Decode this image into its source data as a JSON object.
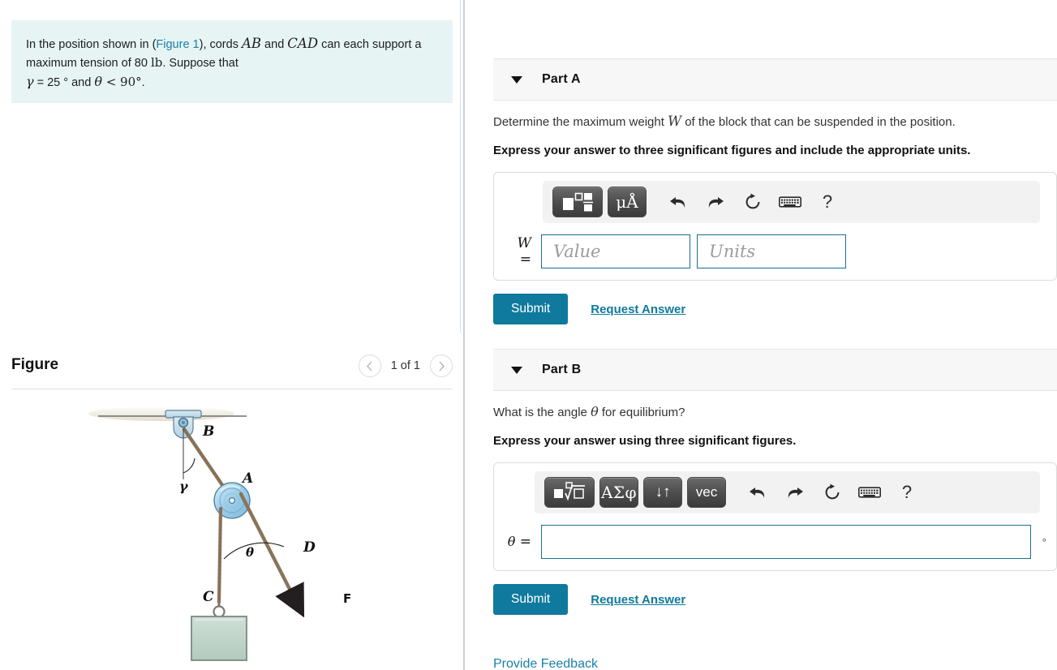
{
  "problem": {
    "line1_a": "In the position shown in (",
    "figure_link": "Figure 1",
    "line1_b": "), cords ",
    "cord1": "AB",
    "and1": " and ",
    "cord2": "CAD",
    "line1_c": " can each",
    "line2": "support a maximum tension of 80 ",
    "unit": "lb",
    "line2_b": ". Suppose that",
    "gamma_sym": "γ",
    "gamma_eq": " = 25 ",
    "deg": "°",
    "and2": " and ",
    "theta_sym": "θ",
    "theta_cond": " < 90°",
    "period": "."
  },
  "figure": {
    "title": "Figure",
    "prev_icon": "chevron-left-icon",
    "next_icon": "chevron-right-icon",
    "counter": "1 of 1",
    "labels": {
      "B": "B",
      "A": "A",
      "C": "C",
      "D": "D",
      "F": "F",
      "gamma": "γ",
      "theta": "θ"
    },
    "colors": {
      "pulley": "#a8d4ea",
      "bracket": "#c3dced",
      "block": "#bdd3c9",
      "cord": "#7d6a55",
      "ceiling": "#e6e1d2"
    }
  },
  "parts": [
    {
      "id": "part-a",
      "caret_icon": "caret-down-icon",
      "title": "Part A",
      "question": "Determine the maximum weight W of the block that can be suspended in the position.",
      "question_pre": "Determine the maximum weight ",
      "question_var": "W",
      "question_post": " of the block that can be suspended in the position.",
      "instruction": "Express your answer to three significant figures and include the appropriate units.",
      "toolbar": [
        {
          "name": "template-fraction-icon",
          "label": "",
          "style": "icon-template"
        },
        {
          "name": "units-micro-angstrom-icon",
          "label": "μÅ",
          "style": "button"
        },
        {
          "name": "undo-icon",
          "label": "",
          "style": "plain"
        },
        {
          "name": "redo-icon",
          "label": "",
          "style": "plain"
        },
        {
          "name": "reset-icon",
          "label": "",
          "style": "plain"
        },
        {
          "name": "keyboard-icon",
          "label": "",
          "style": "plain"
        },
        {
          "name": "help-icon",
          "label": "?",
          "style": "plain"
        }
      ],
      "lhs": "W",
      "equals": "=",
      "value_placeholder": "Value",
      "units_placeholder": "Units",
      "submit_label": "Submit",
      "request_label": "Request Answer"
    },
    {
      "id": "part-b",
      "caret_icon": "caret-down-icon",
      "title": "Part B",
      "question_pre": "What is the angle ",
      "question_var": "θ",
      "question_post": " for equilibrium?",
      "instruction": "Express your answer using three significant figures.",
      "toolbar": [
        {
          "name": "template-root-icon",
          "label": "",
          "style": "icon-root"
        },
        {
          "name": "greek-symbols-icon",
          "label": "ΑΣφ",
          "style": "button"
        },
        {
          "name": "arrows-updown-icon",
          "label": "↓↑",
          "style": "button"
        },
        {
          "name": "vector-icon",
          "label": "vec",
          "style": "button"
        },
        {
          "name": "undo-icon",
          "label": "",
          "style": "plain"
        },
        {
          "name": "redo-icon",
          "label": "",
          "style": "plain"
        },
        {
          "name": "reset-icon",
          "label": "",
          "style": "plain"
        },
        {
          "name": "keyboard-icon",
          "label": "",
          "style": "plain"
        },
        {
          "name": "help-icon",
          "label": "?",
          "style": "plain"
        }
      ],
      "lhs": "θ",
      "equals": "=",
      "answer_value": "",
      "degree_suffix": "°",
      "submit_label": "Submit",
      "request_label": "Request Answer"
    }
  ],
  "footer": {
    "provide_feedback": "Provide Feedback"
  },
  "colors": {
    "accent": "#0f7a9d",
    "link": "#1a7fa8",
    "problem_bg": "#e7f4f4",
    "header_bg": "#f7f7f7",
    "field_border": "#1a6e91"
  }
}
